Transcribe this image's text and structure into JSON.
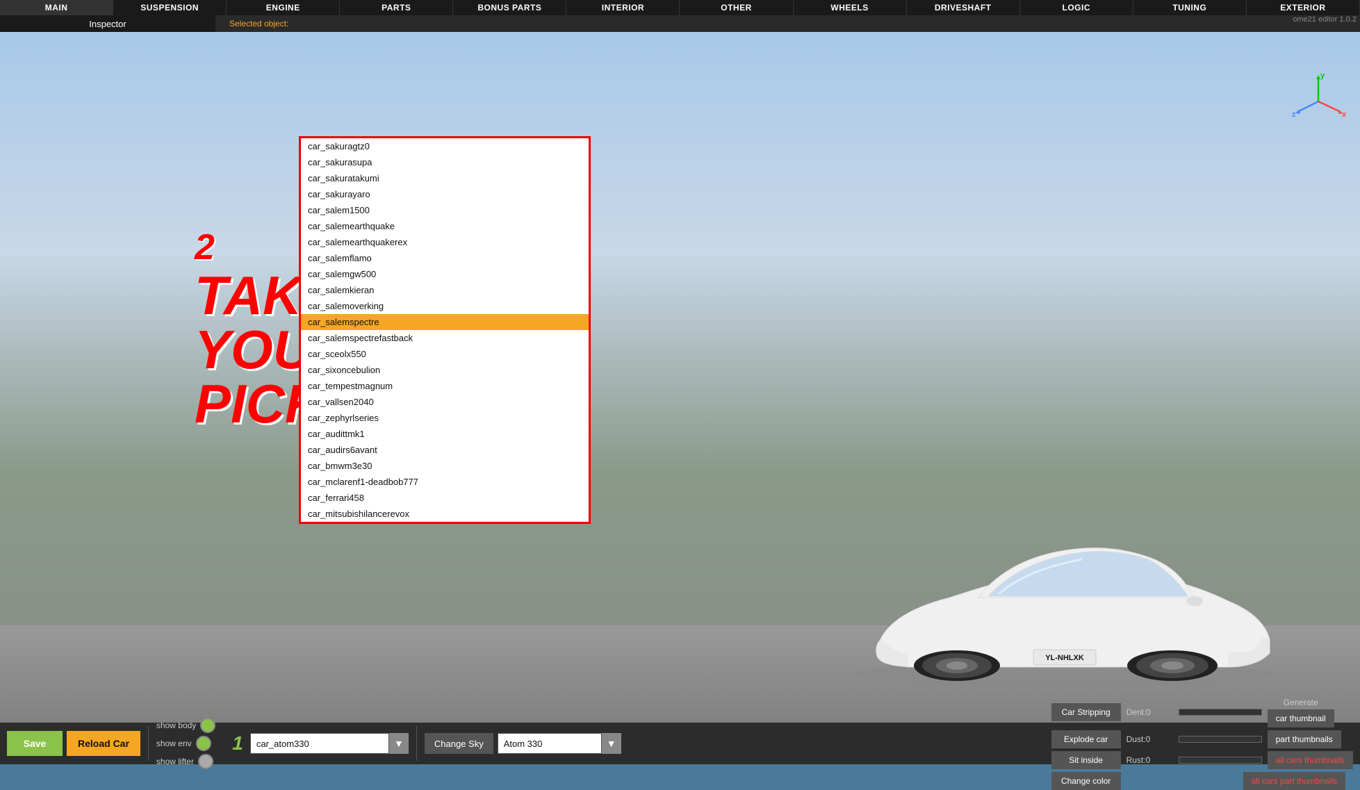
{
  "menu": {
    "items": [
      {
        "label": "MAIN"
      },
      {
        "label": "SUSPENSION"
      },
      {
        "label": "ENGINE"
      },
      {
        "label": "PARTS"
      },
      {
        "label": "BONUS PARTS"
      },
      {
        "label": "INTERIOR"
      },
      {
        "label": "OTHER"
      },
      {
        "label": "WHEELS"
      },
      {
        "label": "DRIVESHAFT"
      },
      {
        "label": "LOGIC"
      },
      {
        "label": "TUNING"
      },
      {
        "label": "EXTERIOR"
      }
    ]
  },
  "inspector": {
    "label": "Inspector"
  },
  "selected_object": {
    "label": "Selected object:"
  },
  "version": "ome21 editor 1.0.2",
  "car_list": {
    "items": [
      "car_sakuragtz0",
      "car_sakurasupa",
      "car_sakuratakumi",
      "car_sakurayaro",
      "car_salem1500",
      "car_salemearthquake",
      "car_salemearthquakerex",
      "car_salemflamo",
      "car_salemgw500",
      "car_salemkieran",
      "car_salemoverking",
      "car_salemspectre",
      "car_salemspectrefastback",
      "car_sceolx550",
      "car_sixoncebulion",
      "car_tempestmagnum",
      "car_vallsen2040",
      "car_zephyrlseries",
      "car_audittmk1",
      "car_audirs6avant",
      "car_bmwm3e30",
      "car_mclarenf1-deadbob777",
      "car_ferrari458",
      "car_mitsubishilancerevox"
    ],
    "selected": "car_salemspectre"
  },
  "overlay": {
    "number": "2",
    "lines": [
      "TAKE",
      "YOUR",
      "PICK!"
    ]
  },
  "bottom": {
    "save_label": "Save",
    "reload_label": "Reload Car",
    "show_body_label": "show body",
    "show_env_label": "show env",
    "show_lifter_label": "show lifter",
    "car_select_value": "car_atom330",
    "change_sky_label": "Change Sky",
    "sky_value": "Atom 330"
  },
  "right_panel": {
    "car_stripping_label": "Car Stripping",
    "dent_label": "Dent:0",
    "explode_label": "Explode car",
    "dust_label": "Dust:0",
    "sit_inside_label": "Sit inside",
    "rust_label": "Rust:0",
    "change_color_label": "Change color",
    "generate_label": "Generate",
    "car_thumbnail_label": "car thumbnail",
    "part_thumbnails_label": "part thumbnails",
    "all_cars_thumbnails_label": "all cars thumbnails",
    "all_cars_part_thumbnails_label": "all cars part thumbnails"
  },
  "plate": "YL-NHLXK"
}
